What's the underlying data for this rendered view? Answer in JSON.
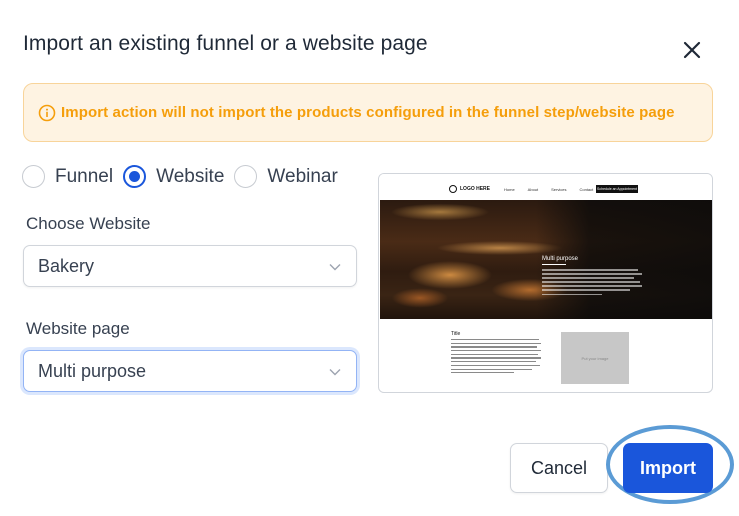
{
  "dialog": {
    "title": "Import an existing funnel or a website page",
    "close_icon": "close-icon"
  },
  "alert": {
    "icon": "info-circle-icon",
    "text": "Import action will not import the products configured in the funnel step/website page",
    "color": "#f59e0b",
    "background": "#fef3e2"
  },
  "source_type": {
    "options": [
      {
        "label": "Funnel",
        "checked": false
      },
      {
        "label": "Website",
        "checked": true
      },
      {
        "label": "Webinar",
        "checked": false
      }
    ]
  },
  "choose_website": {
    "label": "Choose Website",
    "value": "Bakery"
  },
  "website_page": {
    "label": "Website page",
    "value": "Multi purpose"
  },
  "preview": {
    "logo_text": "LOGO HERE",
    "nav_links": [
      "Home",
      "About",
      "Services",
      "Contact"
    ],
    "cta": "Schedule an Appointment",
    "hero_title": "Multi purpose",
    "body_title": "Title",
    "image_placeholder": "Put your image"
  },
  "actions": {
    "cancel_label": "Cancel",
    "import_label": "Import",
    "accent": "#1a56db"
  }
}
